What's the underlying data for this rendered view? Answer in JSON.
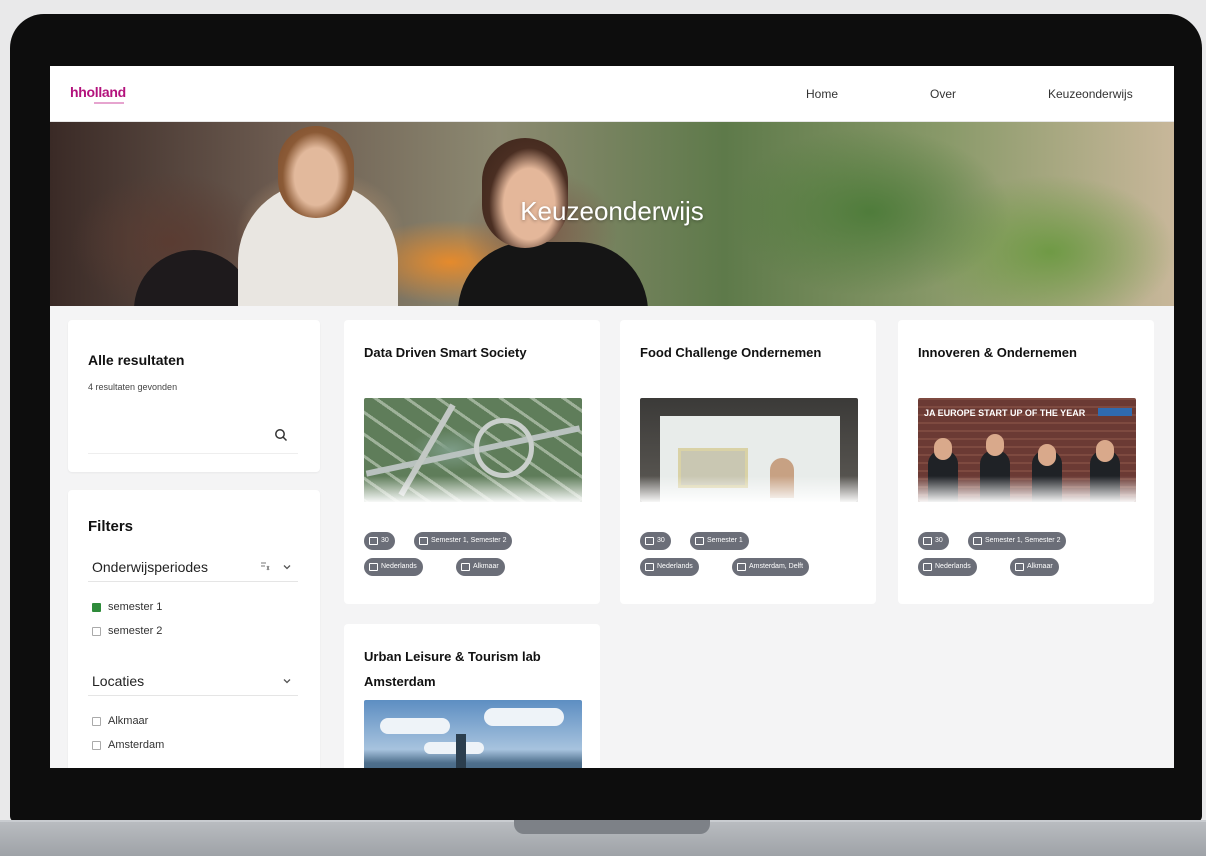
{
  "site": {
    "logo": "hholland",
    "nav": [
      "Home",
      "Over",
      "Keuzeonderwijs"
    ]
  },
  "hero": {
    "title": "Keuzeonderwijs"
  },
  "sidebar": {
    "results_title": "Alle resultaten",
    "results_count": "4 resultaten gevonden",
    "search_placeholder": "",
    "filters_title": "Filters",
    "periods_label": "Onderwijsperiodes",
    "periods": [
      {
        "label": "semester 1",
        "checked": true
      },
      {
        "label": "semester 2",
        "checked": false
      }
    ],
    "locations_label": "Locaties",
    "locations": [
      {
        "label": "Alkmaar",
        "checked": false
      },
      {
        "label": "Amsterdam",
        "checked": false
      }
    ]
  },
  "courses": [
    {
      "title": "Data Driven Smart Society",
      "tags": [
        "30",
        "Semester 1, Semester 2",
        "Nederlands",
        "Alkmaar"
      ]
    },
    {
      "title": "Food Challenge Ondernemen",
      "tags": [
        "30",
        "Semester 1",
        "Nederlands",
        "Amsterdam, Delft"
      ]
    },
    {
      "title": "Innoveren & Ondernemen",
      "tags": [
        "30",
        "Semester 1, Semester 2",
        "Nederlands",
        "Alkmaar"
      ]
    },
    {
      "title": "Urban Leisure & Tourism lab Amsterdam",
      "tags": []
    }
  ],
  "image_text": {
    "startup_banner": "JA EUROPE START UP OF THE YEAR"
  },
  "colors": {
    "brand": "#b3127c",
    "tag": "#6b6e78",
    "checkbox_on": "#2e8b3a"
  }
}
